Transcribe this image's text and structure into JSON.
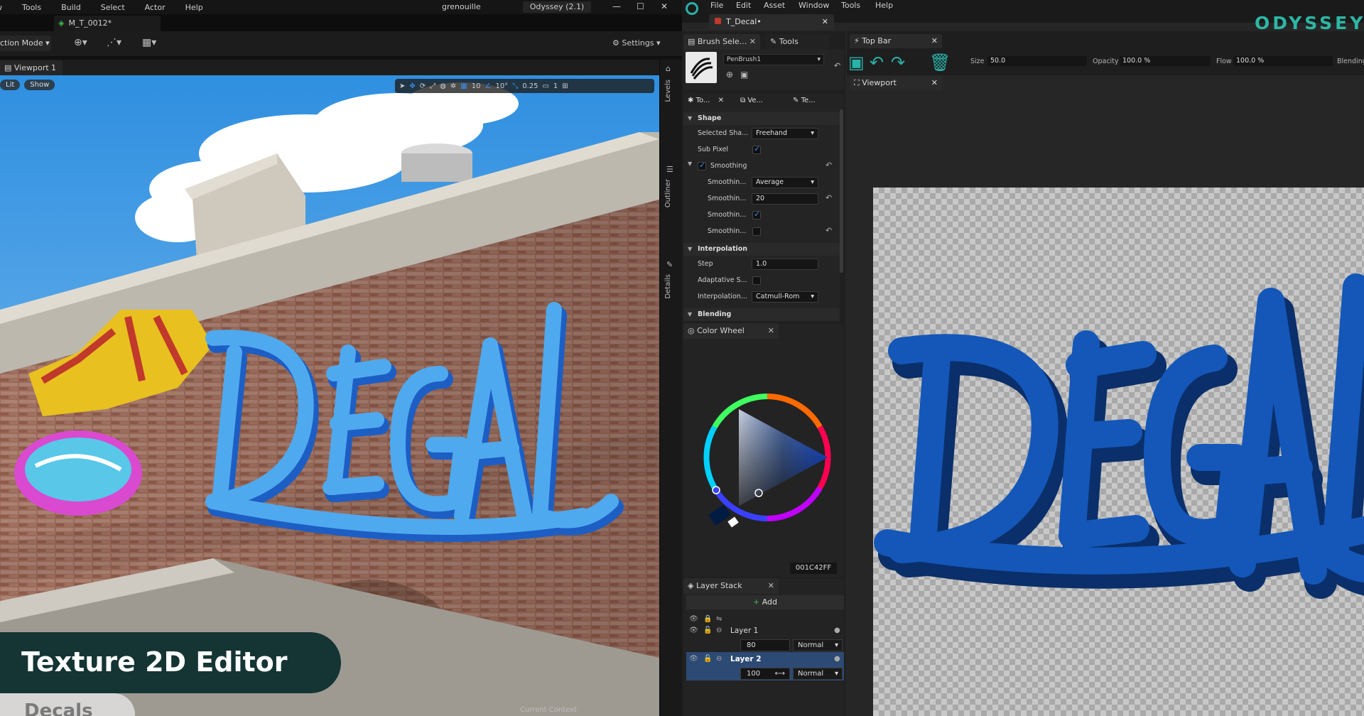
{
  "ue": {
    "menu": [
      "w",
      "Tools",
      "Build",
      "Select",
      "Actor",
      "Help"
    ],
    "project": "grenouille",
    "version": "Odyssey (2.1)",
    "asset_tab": "M_T_0012*",
    "mode": "ction Mode",
    "settings": "Settings",
    "viewport_tab": "Viewport 1",
    "lit": "Lit",
    "show": "Show",
    "grid_value": "10",
    "angle_value": "10°",
    "scale_value": "0.25",
    "camera_value": "1",
    "side_tabs": [
      "Levels",
      "Outliner",
      "Details"
    ],
    "context_label": "Current Context"
  },
  "banner": {
    "title": "Texture 2D Editor",
    "subtitle": "Decals"
  },
  "odyssey": {
    "menu": [
      "File",
      "Edit",
      "Asset",
      "Window",
      "Tools",
      "Help"
    ],
    "brand": "ODYSSEY",
    "doc_tab": "T_Decal•",
    "panel_tabs": {
      "brush": "Brush Sele...",
      "tools": "Tools",
      "topbar": "Top Bar",
      "viewport": "Viewport"
    },
    "brush_name": "PenBrush1",
    "prop_tabs": [
      "To...",
      "Ve...",
      "Te..."
    ],
    "sections": {
      "shape": "Shape",
      "interpolation": "Interpolation",
      "blending": "Blending"
    },
    "props": {
      "selected_shape_label": "Selected Sha...",
      "selected_shape_value": "Freehand",
      "sub_pixel_label": "Sub Pixel",
      "smoothing_label": "Smoothing",
      "smoothing_mode_label": "Smoothin...",
      "smoothing_mode_value": "Average",
      "smoothing_amount_label": "Smoothin...",
      "smoothing_amount_value": "20",
      "smoothing_c_label": "Smoothin...",
      "smoothing_d_label": "Smoothin...",
      "step_label": "Step",
      "step_value": "1.0",
      "adaptive_label": "Adaptative S...",
      "interp_label": "Interpolation...",
      "interp_value": "Catmull-Rom"
    },
    "color_wheel": {
      "title": "Color Wheel",
      "hex": "001C42FF",
      "color": "#001C42"
    },
    "layer_stack": {
      "title": "Layer Stack",
      "add": "Add",
      "layers": [
        {
          "name": "Layer 1",
          "opacity": "80",
          "mode": "Normal"
        },
        {
          "name": "Layer 2",
          "opacity": "100",
          "mode": "Normal"
        }
      ]
    },
    "topbar": {
      "size_label": "Size",
      "size_value": "50.0",
      "opacity_label": "Opacity",
      "opacity_value": "100.0 %",
      "flow_label": "Flow",
      "flow_value": "100.0 %",
      "blending_label": "Blending"
    },
    "canvas_text": "DEGAL"
  },
  "colors": {
    "accent": "#2ab1a8",
    "decal_blue": "#0d4f9a",
    "selection_blue": "#3d8bfd"
  }
}
